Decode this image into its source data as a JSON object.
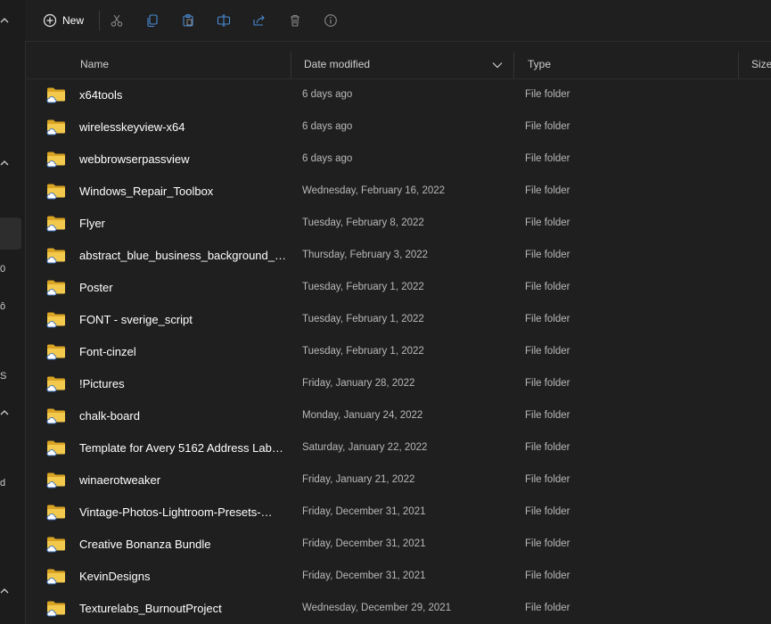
{
  "toolbar": {
    "new_label": "New",
    "icons": [
      "cut-icon",
      "copy-icon",
      "paste-icon",
      "rename-icon",
      "share-icon",
      "delete-icon",
      "properties-icon"
    ]
  },
  "columns": {
    "name": "Name",
    "date": "Date modified",
    "type": "Type",
    "size": "Size"
  },
  "sidebar": {
    "glyphs": [
      "0",
      "ô",
      "S",
      "d"
    ]
  },
  "files": [
    {
      "name": "x64tools",
      "date": "6 days ago",
      "type": "File folder"
    },
    {
      "name": "wirelesskeyview-x64",
      "date": "6 days ago",
      "type": "File folder"
    },
    {
      "name": "webbrowserpassview",
      "date": "6 days ago",
      "type": "File folder"
    },
    {
      "name": "Windows_Repair_Toolbox",
      "date": "Wednesday, February 16, 2022",
      "type": "File folder"
    },
    {
      "name": "Flyer",
      "date": "Tuesday, February 8, 2022",
      "type": "File folder"
    },
    {
      "name": "abstract_blue_business_background_…",
      "date": "Thursday, February 3, 2022",
      "type": "File folder"
    },
    {
      "name": "Poster",
      "date": "Tuesday, February 1, 2022",
      "type": "File folder"
    },
    {
      "name": "FONT - sverige_script",
      "date": "Tuesday, February 1, 2022",
      "type": "File folder"
    },
    {
      "name": "Font-cinzel",
      "date": "Tuesday, February 1, 2022",
      "type": "File folder"
    },
    {
      "name": "!Pictures",
      "date": "Friday, January 28, 2022",
      "type": "File folder"
    },
    {
      "name": "chalk-board",
      "date": "Monday, January 24, 2022",
      "type": "File folder"
    },
    {
      "name": "Template for Avery 5162 Address Lab…",
      "date": "Saturday, January 22, 2022",
      "type": "File folder"
    },
    {
      "name": "winaerotweaker",
      "date": "Friday, January 21, 2022",
      "type": "File folder"
    },
    {
      "name": "Vintage-Photos-Lightroom-Presets-…",
      "date": "Friday, December 31, 2021",
      "type": "File folder"
    },
    {
      "name": "Creative Bonanza Bundle",
      "date": "Friday, December 31, 2021",
      "type": "File folder"
    },
    {
      "name": "KevinDesigns",
      "date": "Friday, December 31, 2021",
      "type": "File folder"
    },
    {
      "name": "Texturelabs_BurnoutProject",
      "date": "Wednesday, December 29, 2021",
      "type": "File folder"
    }
  ]
}
